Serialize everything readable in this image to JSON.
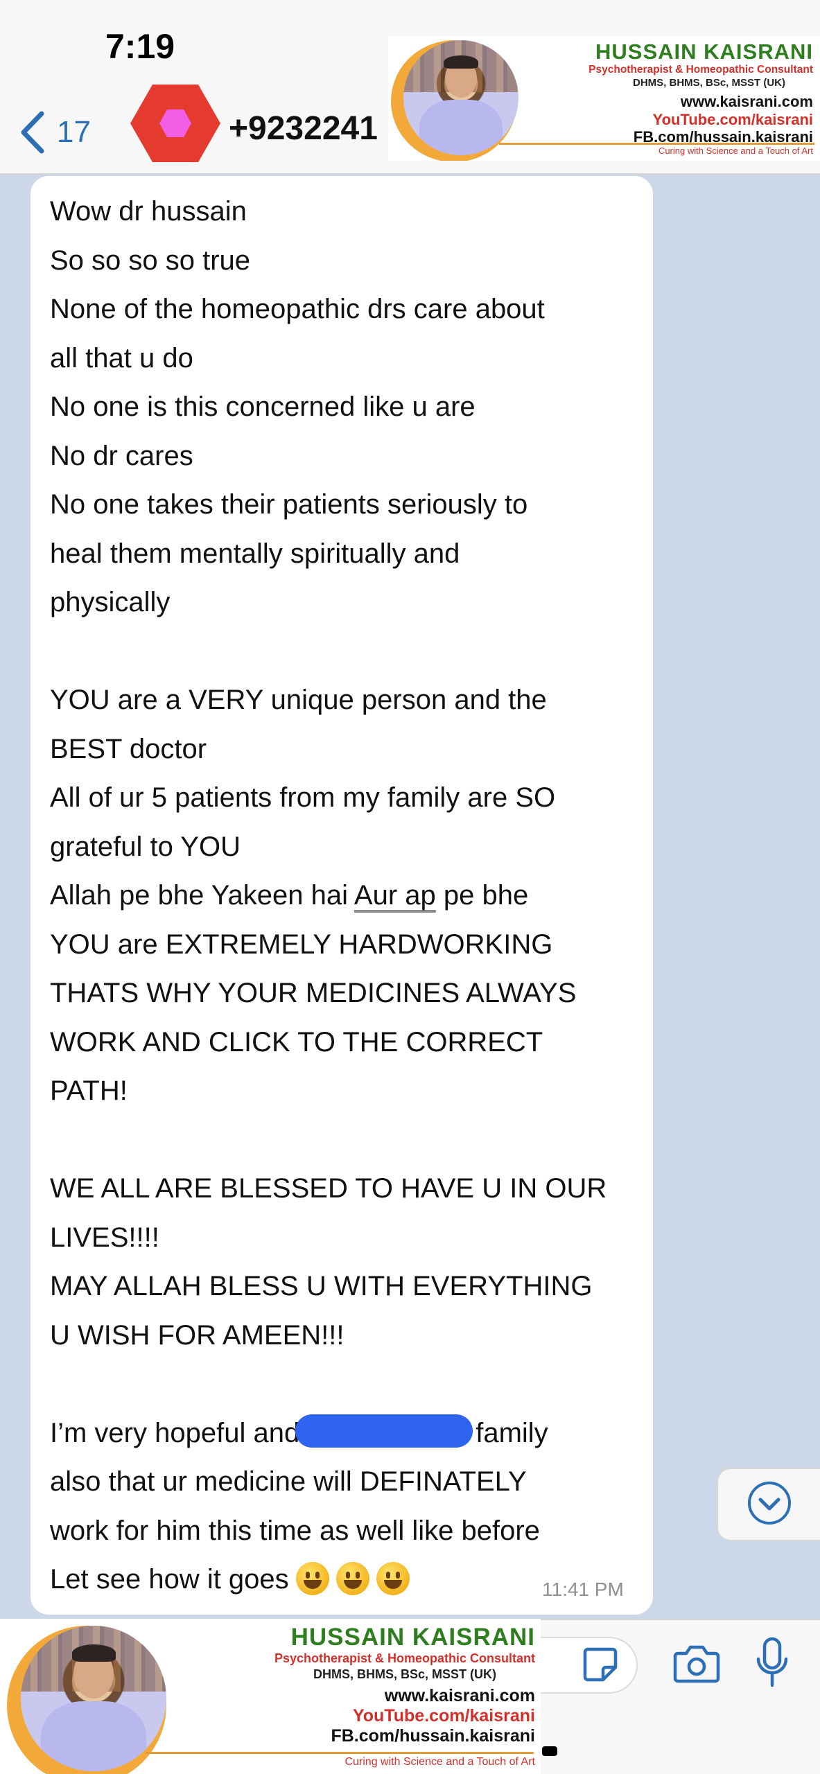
{
  "status_bar": {
    "time": "7:19"
  },
  "header": {
    "back_count": "17",
    "contact_name": "+9232241",
    "avatar_color": "#e53a2e"
  },
  "watermark": {
    "name": "HUSSAIN KAISRANI",
    "title": "Psychotherapist & Homeopathic Consultant",
    "degrees": "DHMS, BHMS, BSc, MSST (UK)",
    "website": "www.kaisrani.com",
    "youtube": "YouTube.com/kaisrani",
    "facebook": "FB.com/hussain.kaisrani",
    "tagline": "Curing with Science and a Touch of Art"
  },
  "message": {
    "lines": [
      "Wow dr hussain",
      "So so so so true",
      "None of the homeopathic drs care about",
      "all that u do",
      "No one is this concerned like u are",
      "No dr cares",
      "No one takes their patients seriously to",
      "heal them mentally spiritually and",
      "physically",
      "",
      "YOU are a VERY unique person and the",
      "BEST doctor",
      "All of ur 5 patients from my family are SO",
      "grateful to YOU",
      "",
      "YOU are EXTREMELY HARDWORKING",
      "THATS WHY YOUR MEDICINES ALWAYS",
      "WORK AND CLICK TO THE CORRECT",
      "PATH!",
      "",
      "WE ALL ARE BLESSED TO HAVE U IN OUR",
      "LIVES!!!!",
      "MAY ALLAH BLESS U WITH EVERYTHING",
      "U WISH FOR AMEEN!!!",
      "",
      "",
      "also that ur medicine will DEFINATELY",
      "work for him this time as well like before",
      ""
    ],
    "allah_line_before": "Allah pe bhe Yakeen hai ",
    "allah_line_link": "Aur ap",
    "allah_line_after": " pe bhe",
    "hopeful_before": "I’m very hopeful and",
    "hopeful_after": "family",
    "last_line": "Let see how it goes",
    "timestamp": "11:41 PM"
  },
  "icons": {
    "back": "chevron-left-icon",
    "scroll_down": "chevron-down-circle-icon",
    "sticker": "sticker-icon",
    "camera": "camera-icon",
    "mic": "microphone-icon"
  },
  "colors": {
    "accent": "#2d6fb4",
    "chat_background": "#ccd8e8",
    "redaction": "#2f64f0"
  }
}
